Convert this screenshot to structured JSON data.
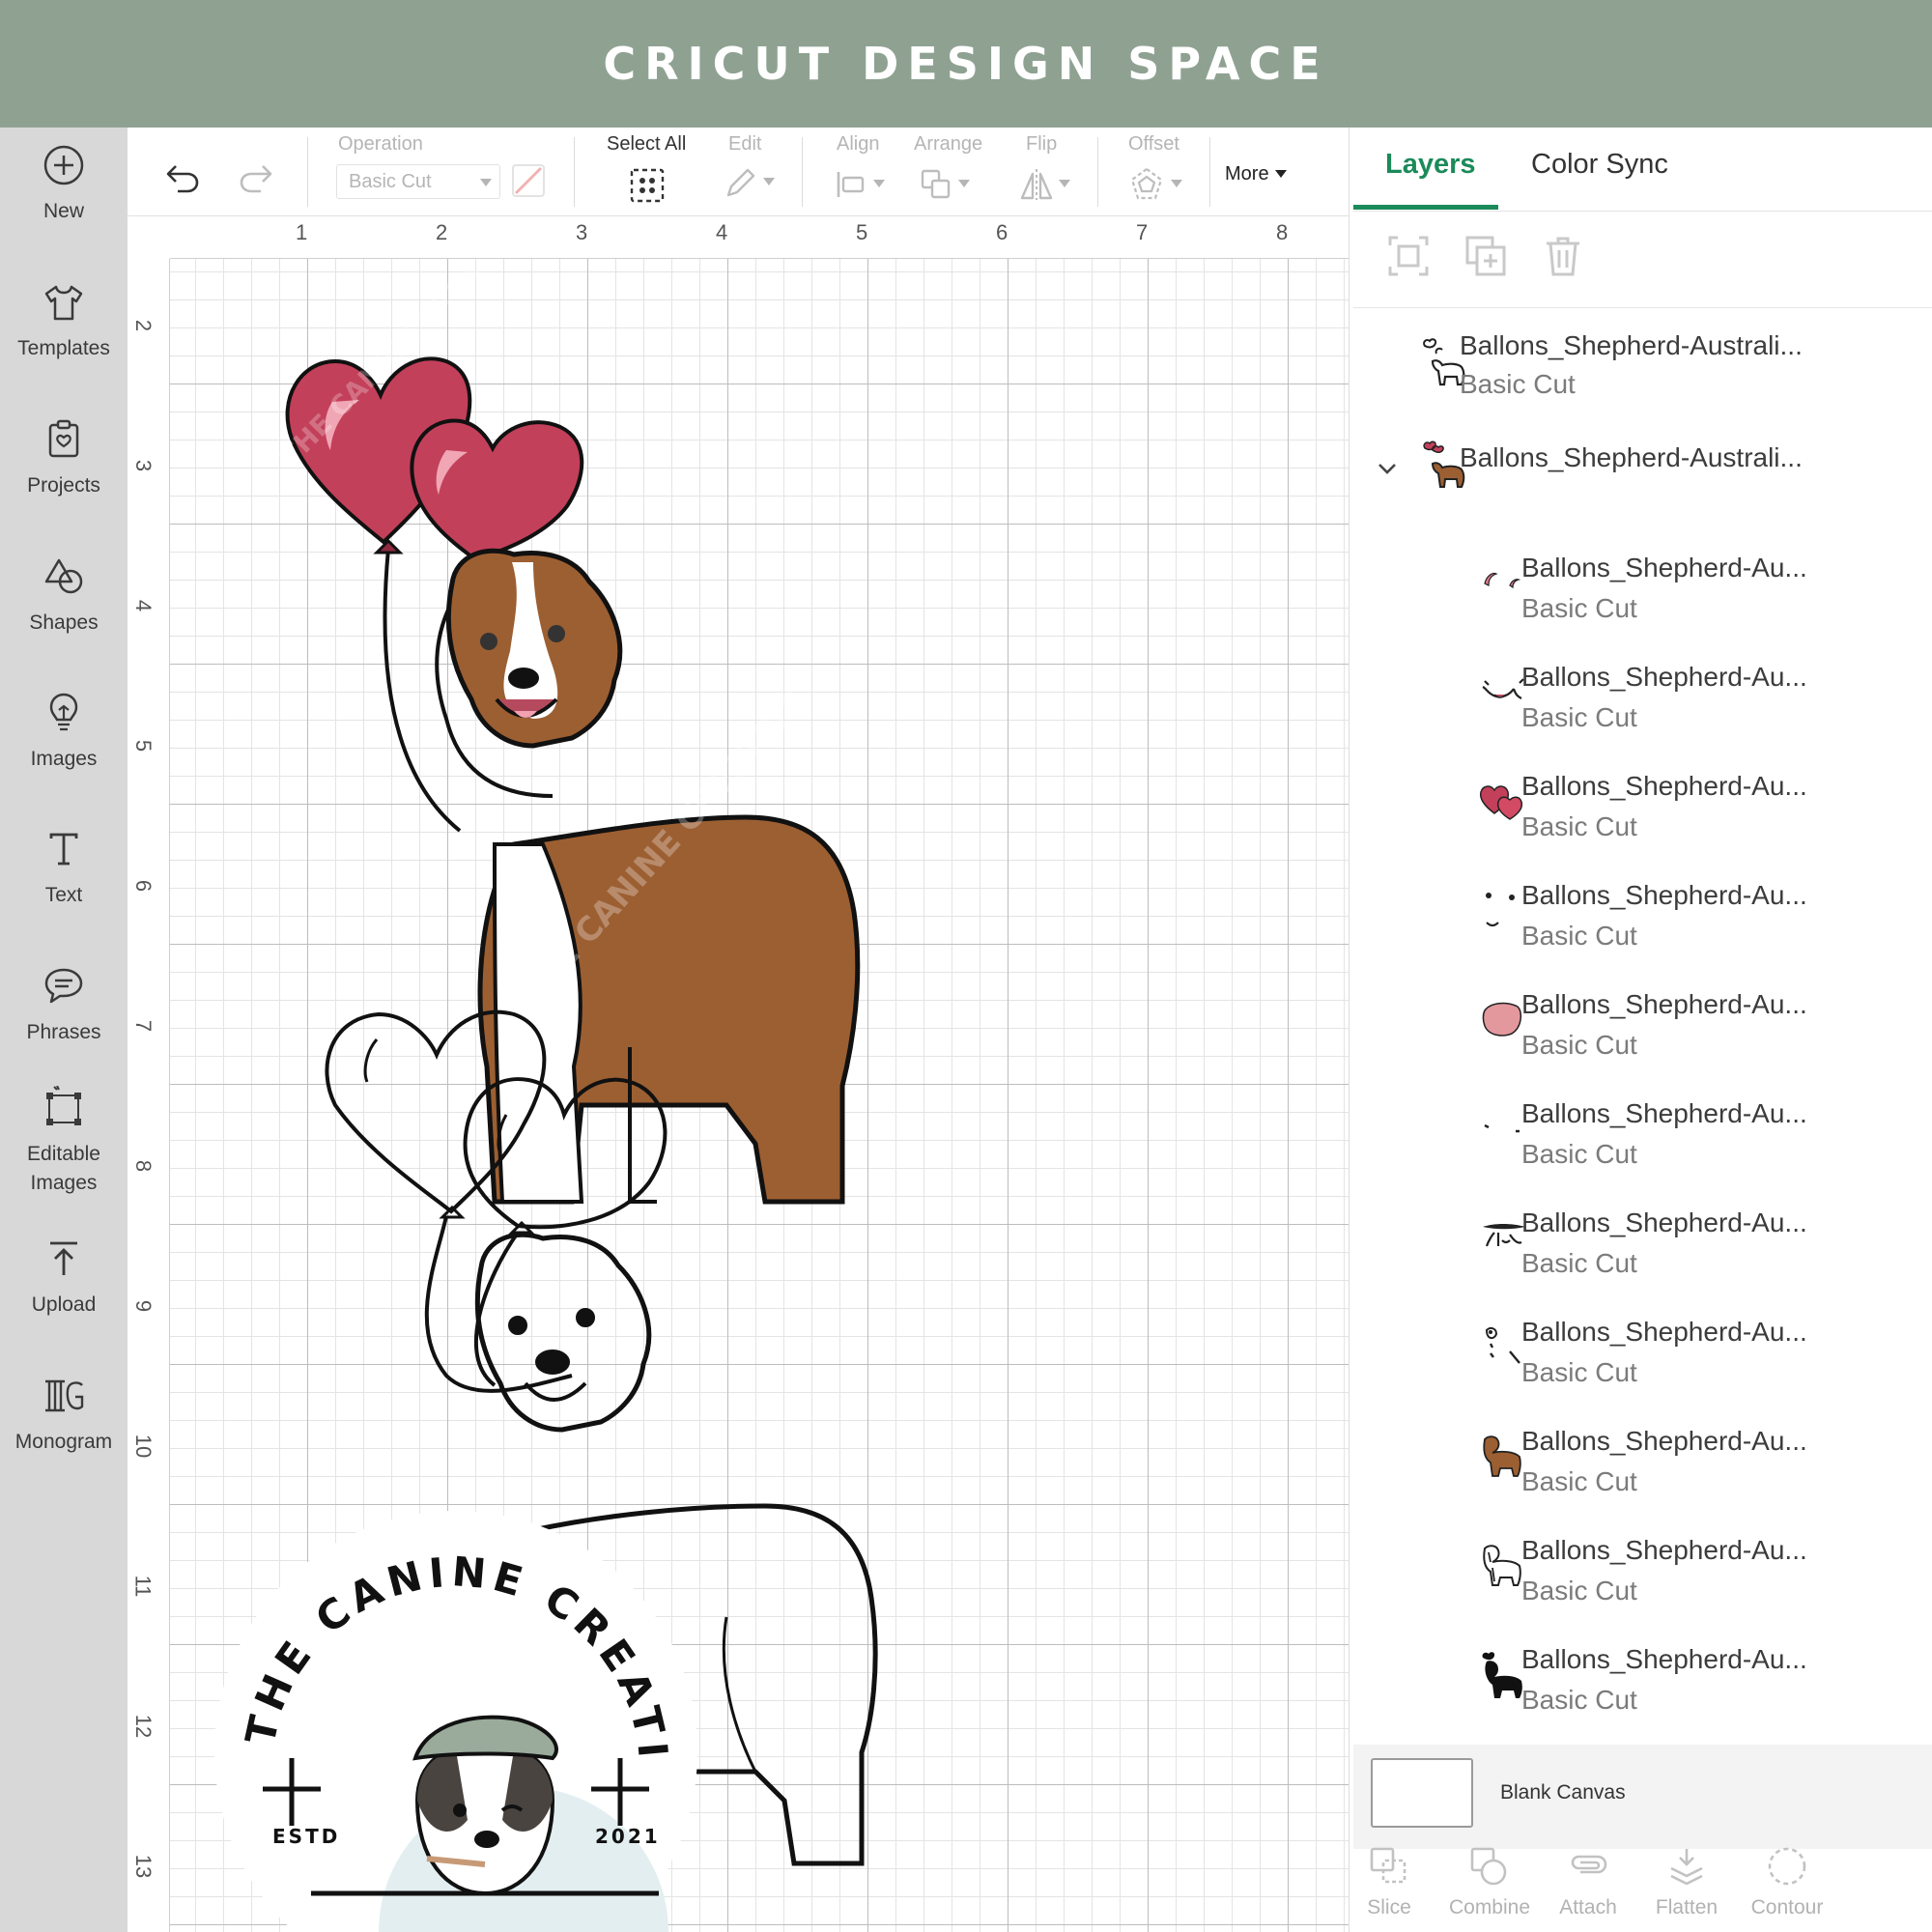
{
  "banner": {
    "title": "CRICUT DESIGN SPACE"
  },
  "sidebar": {
    "items": [
      {
        "label": "New",
        "icon": "plus-circle-icon"
      },
      {
        "label": "Templates",
        "icon": "t-shirt-icon"
      },
      {
        "label": "Projects",
        "icon": "projects-icon"
      },
      {
        "label": "Shapes",
        "icon": "shapes-icon"
      },
      {
        "label": "Images",
        "icon": "lightbulb-icon"
      },
      {
        "label": "Text",
        "icon": "text-icon"
      },
      {
        "label": "Phrases",
        "icon": "speech-bubble-icon"
      },
      {
        "label": "Editable\nImages",
        "icon": "editable-images-icon"
      },
      {
        "label": "Upload",
        "icon": "upload-icon"
      },
      {
        "label": "Monogram",
        "icon": "monogram-icon"
      }
    ]
  },
  "toolbar": {
    "operation_label": "Operation",
    "operation_value": "Basic Cut",
    "select_all_label": "Select All",
    "edit_label": "Edit",
    "align_label": "Align",
    "arrange_label": "Arrange",
    "flip_label": "Flip",
    "offset_label": "Offset",
    "more_label": "More"
  },
  "canvas": {
    "ruler_top": [
      "1",
      "2",
      "3",
      "4",
      "5",
      "6",
      "7",
      "8"
    ],
    "ruler_left": [
      "2",
      "3",
      "4",
      "5",
      "6",
      "7",
      "8",
      "9",
      "10",
      "11",
      "12",
      "13"
    ],
    "watermark": "THE CANINE CREATIVE",
    "logo": {
      "arc_text": "THE CANINE CREATIVE",
      "left_text": "ESTD",
      "right_text": "2021"
    }
  },
  "panel": {
    "tabs": [
      "Layers",
      "Color Sync"
    ],
    "active_tab": "Layers",
    "layer_tools": [
      "group-icon",
      "duplicate-icon",
      "delete-icon"
    ],
    "layers": [
      {
        "name": "Ballons_Shepherd-Australi...",
        "operation": "Basic Cut",
        "thumb": "outline-dog-thumbnail"
      },
      {
        "name": "Ballons_Shepherd-Australi...",
        "operation": "",
        "thumb": "color-dog-thumbnail",
        "expanded": true
      },
      {
        "name": "Ballons_Shepherd-Au...",
        "operation": "Basic Cut",
        "thumb": "balloon-highlights-thumbnail"
      },
      {
        "name": "Ballons_Shepherd-Au...",
        "operation": "Basic Cut",
        "thumb": "mouth-thumbnail"
      },
      {
        "name": "Ballons_Shepherd-Au...",
        "operation": "Basic Cut",
        "thumb": "red-hearts-thumbnail"
      },
      {
        "name": "Ballons_Shepherd-Au...",
        "operation": "Basic Cut",
        "thumb": "eyes-thumbnail"
      },
      {
        "name": "Ballons_Shepherd-Au...",
        "operation": "Basic Cut",
        "thumb": "pink-tongue-thumbnail"
      },
      {
        "name": "Ballons_Shepherd-Au...",
        "operation": "Basic Cut",
        "thumb": "small-marks-thumbnail"
      },
      {
        "name": "Ballons_Shepherd-Au...",
        "operation": "Basic Cut",
        "thumb": "nose-detail-thumbnail"
      },
      {
        "name": "Ballons_Shepherd-Au...",
        "operation": "Basic Cut",
        "thumb": "face-detail-thumbnail"
      },
      {
        "name": "Ballons_Shepherd-Au...",
        "operation": "Basic Cut",
        "thumb": "brown-coat-thumbnail"
      },
      {
        "name": "Ballons_Shepherd-Au...",
        "operation": "Basic Cut",
        "thumb": "white-dog-thumbnail"
      },
      {
        "name": "Ballons_Shepherd-Au...",
        "operation": "Basic Cut",
        "thumb": "black-silhouette-thumbnail"
      }
    ],
    "blank_canvas_label": "Blank Canvas",
    "bottom_tools": [
      {
        "label": "Slice",
        "icon": "slice-icon"
      },
      {
        "label": "Combine",
        "icon": "combine-icon"
      },
      {
        "label": "Attach",
        "icon": "attach-icon"
      },
      {
        "label": "Flatten",
        "icon": "flatten-icon"
      },
      {
        "label": "Contour",
        "icon": "contour-icon"
      }
    ]
  },
  "colors": {
    "banner": "#8fa292",
    "accent_green": "#1b8a5a",
    "heart_red": "#c3405a",
    "dog_brown": "#9c5f32",
    "sidebar": "#d8d8d8"
  }
}
